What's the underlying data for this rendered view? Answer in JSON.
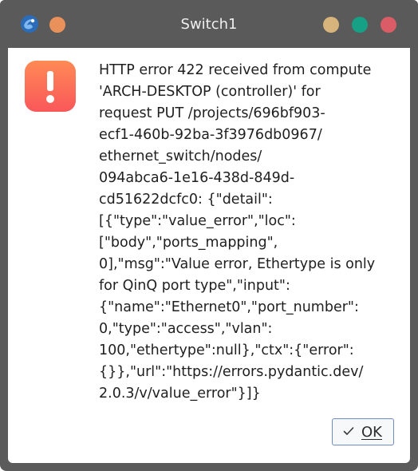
{
  "window": {
    "title": "Switch1",
    "app_icon": "gns3-app-icon",
    "controls": [
      "minimize-icon",
      "maximize-icon",
      "close-icon"
    ],
    "colors": {
      "titlebar": "#5a5a5a",
      "minimize": "#d7b47b",
      "maximize": "#16a085",
      "close": "#d95c67",
      "title_left_dot": "#e9915a"
    }
  },
  "dialog": {
    "icon": "error-exclamation-icon",
    "icon_colors": [
      "#ff8a55",
      "#f9575a"
    ],
    "message_lines": [
      "HTTP error 422 received from compute",
      "'ARCH-DESKTOP (controller)' for",
      "request PUT /projects/696bf903-",
      "ecf1-460b-92ba-3f3976db0967/",
      "ethernet_switch/nodes/",
      "094abca6-1e16-438d-849d-",
      "cd51622dcfc0: {\"detail\":",
      "[{\"type\":\"value_error\",\"loc\":",
      "[\"body\",\"ports_mapping\",",
      "0],\"msg\":\"Value error, Ethertype is only",
      "for QinQ port type\",\"input\":",
      "{\"name\":\"Ethernet0\",\"port_number\":",
      "0,\"type\":\"access\",\"vlan\":",
      "100,\"ethertype\":null},\"ctx\":{\"error\":",
      "{}},\"url\":\"https://errors.pydantic.dev/",
      "2.0.3/v/value_error\"}]}"
    ],
    "ok_button": {
      "label": "OK",
      "icon": "checkmark-icon"
    }
  }
}
